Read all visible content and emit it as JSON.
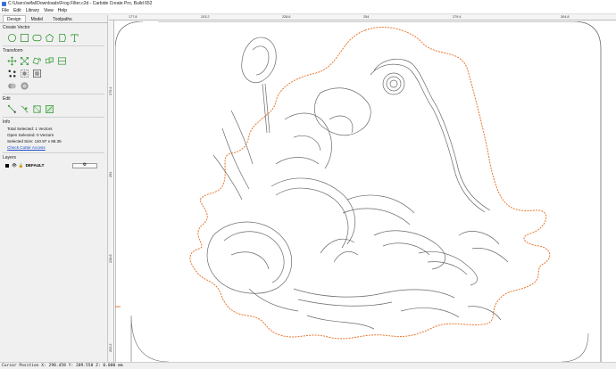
{
  "window": {
    "title": "C:\\Users\\wifal\\Downloads\\Frog Filter.c2d - Carbide Create Pro, Build 652"
  },
  "menu": [
    "File",
    "Edit",
    "Library",
    "View",
    "Help"
  ],
  "tabs": [
    "Design",
    "Model",
    "Toolpaths"
  ],
  "sections": {
    "create_vector": "Create Vector",
    "transform": "Transform",
    "edit": "Edit",
    "info": "Info",
    "layers": "Layers"
  },
  "info": {
    "total_selected": "Total Selected:  1 Vectors",
    "open_selected": "Open Selected:  0 Vectors",
    "selected_size": "Selected Size:   110.97 x 88.35",
    "check_cutter_access": "Check Cutter Access"
  },
  "layers": [
    {
      "name": "DEFAULT",
      "color": "#000000"
    }
  ],
  "ruler": {
    "top_ticks": [
      "177.8",
      "203.2",
      "228.6",
      "254",
      "279.4",
      "304.8"
    ],
    "left_ticks": [
      "279.4",
      "254",
      "228.6",
      "203.2"
    ]
  },
  "status": {
    "cursor": "Cursor Position X: 298.458 Y: 209.550 Z: 0.000 mm"
  },
  "colors": {
    "selection_orange": "#e8762d",
    "vector_gray": "#6a6a6a",
    "tool_green": "#3a9a3a"
  }
}
